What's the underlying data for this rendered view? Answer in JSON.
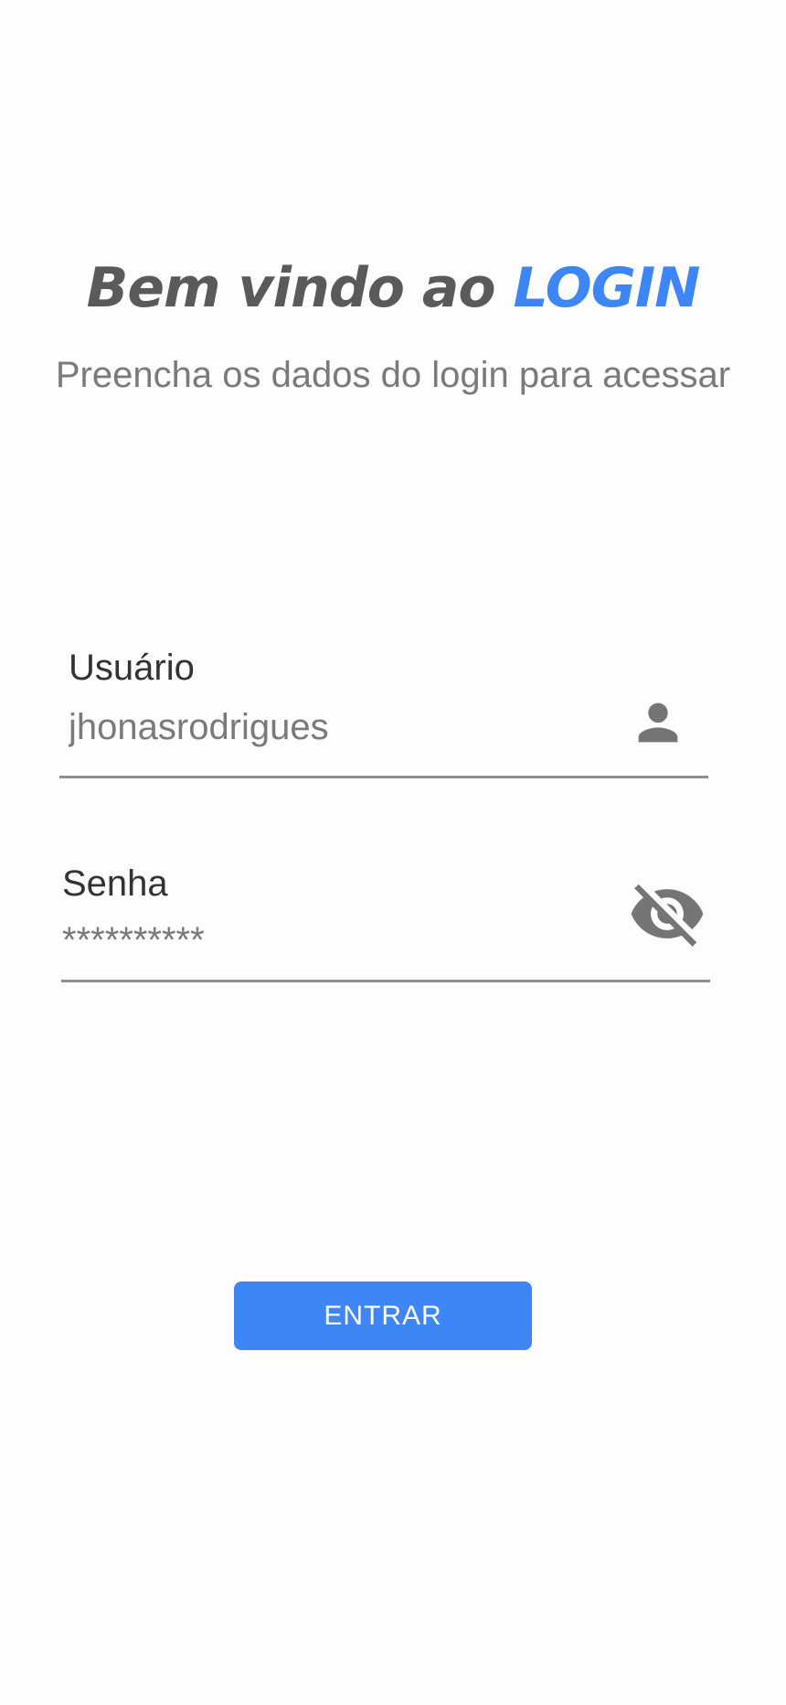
{
  "header": {
    "title_prefix": "Bem vindo ao ",
    "title_accent": "LOGIN",
    "subtitle": "Preencha os dados do login para acessar"
  },
  "username": {
    "label": "Usuário",
    "value": "jhonasrodrigues",
    "icon": "person-icon"
  },
  "password": {
    "label": "Senha",
    "value": "**********",
    "icon": "eye-off-icon"
  },
  "actions": {
    "enter_label": "ENTRAR"
  },
  "colors": {
    "accent": "#3e85f5",
    "title_text": "#5a5a5a",
    "muted_text": "#7a7a7a",
    "label_text": "#333333",
    "icon": "#757575",
    "underline": "#8f8f8f",
    "background": "#fdfdfd"
  }
}
